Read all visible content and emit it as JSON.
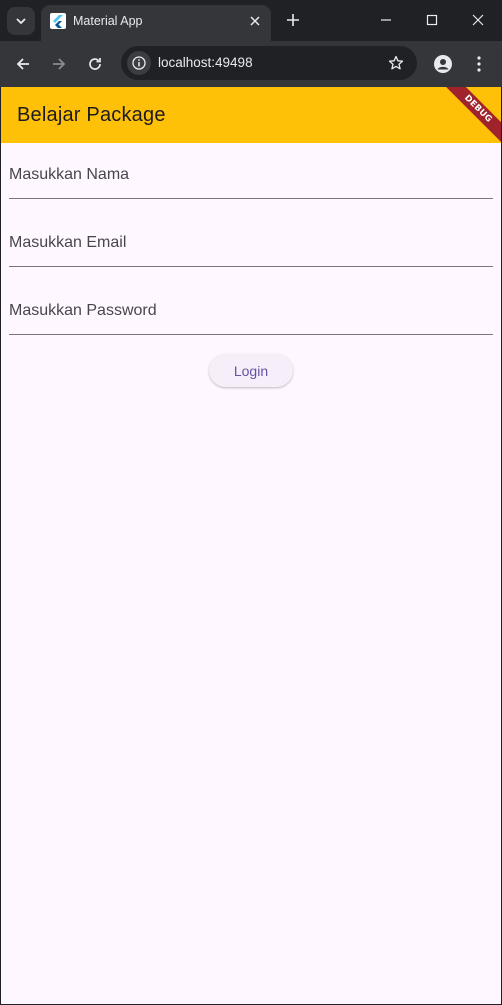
{
  "browser": {
    "tab_title": "Material App",
    "url": "localhost:49498"
  },
  "app": {
    "title": "Belajar Package",
    "debug_banner": "DEBUG",
    "colors": {
      "appbar": "#ffc107",
      "background": "#fef7ff",
      "button_text": "#6750a4"
    }
  },
  "form": {
    "name_placeholder": "Masukkan Nama",
    "email_placeholder": "Masukkan Email",
    "password_placeholder": "Masukkan Password",
    "login_label": "Login"
  },
  "icons": {
    "tab_search": "chevron-down-icon",
    "favicon": "flutter-icon",
    "tab_close": "close-icon",
    "new_tab": "plus-icon",
    "back": "arrow-left-icon",
    "forward": "arrow-right-icon",
    "reload": "reload-icon",
    "site_info": "info-icon",
    "bookmark": "star-icon",
    "profile": "person-icon",
    "menu": "kebab-menu-icon"
  }
}
